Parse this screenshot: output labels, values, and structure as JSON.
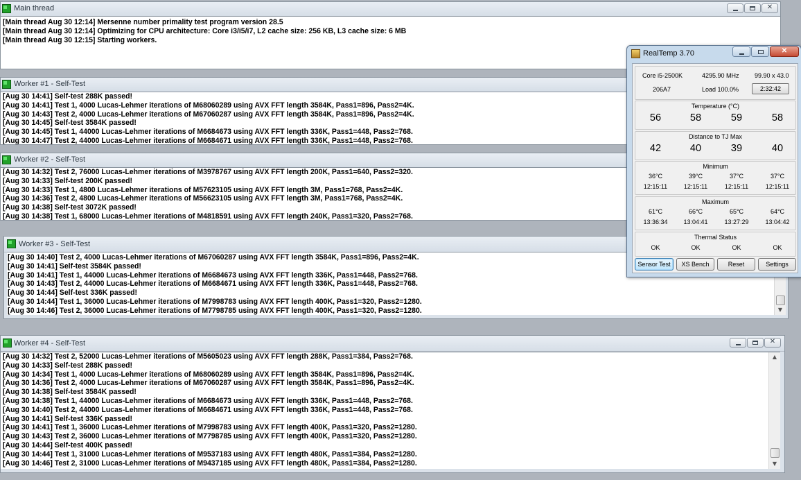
{
  "main": {
    "title": "Main thread",
    "lines": [
      "[Main thread Aug 30 12:14] Mersenne number primality test program version 28.5",
      "[Main thread Aug 30 12:14] Optimizing for CPU architecture: Core i3/i5/i7, L2 cache size: 256 KB, L3 cache size: 6 MB",
      "[Main thread Aug 30 12:15] Starting workers."
    ]
  },
  "workers": [
    {
      "title": "Worker #1 - Self-Test",
      "lines": [
        "[Aug 30 14:41] Self-test 288K passed!",
        "[Aug 30 14:41] Test 1, 4000 Lucas-Lehmer iterations of M68060289 using AVX FFT length 3584K, Pass1=896, Pass2=4K.",
        "[Aug 30 14:43] Test 2, 4000 Lucas-Lehmer iterations of M67060287 using AVX FFT length 3584K, Pass1=896, Pass2=4K.",
        "[Aug 30 14:45] Self-test 3584K passed!",
        "[Aug 30 14:45] Test 1, 44000 Lucas-Lehmer iterations of M6684673 using AVX FFT length 336K, Pass1=448, Pass2=768.",
        "[Aug 30 14:47] Test 2, 44000 Lucas-Lehmer iterations of M6684671 using AVX FFT length 336K, Pass1=448, Pass2=768."
      ]
    },
    {
      "title": "Worker #2 - Self-Test",
      "lines": [
        "[Aug 30 14:32] Test 2, 76000 Lucas-Lehmer iterations of M3978767 using AVX FFT length 200K, Pass1=640, Pass2=320.",
        "[Aug 30 14:33] Self-test 200K passed!",
        "[Aug 30 14:33] Test 1, 4800 Lucas-Lehmer iterations of M57623105 using AVX FFT length 3M, Pass1=768, Pass2=4K.",
        "[Aug 30 14:36] Test 2, 4800 Lucas-Lehmer iterations of M56623105 using AVX FFT length 3M, Pass1=768, Pass2=4K.",
        "[Aug 30 14:38] Self-test 3072K passed!",
        "[Aug 30 14:38] Test 1, 68000 Lucas-Lehmer iterations of M4818591 using AVX FFT length 240K, Pass1=320, Pass2=768."
      ]
    },
    {
      "title": "Worker #3 - Self-Test",
      "lines": [
        "[Aug 30 14:40] Test 2, 4000 Lucas-Lehmer iterations of M67060287 using AVX FFT length 3584K, Pass1=896, Pass2=4K.",
        "[Aug 30 14:41] Self-test 3584K passed!",
        "[Aug 30 14:41] Test 1, 44000 Lucas-Lehmer iterations of M6684673 using AVX FFT length 336K, Pass1=448, Pass2=768.",
        "[Aug 30 14:43] Test 2, 44000 Lucas-Lehmer iterations of M6684671 using AVX FFT length 336K, Pass1=448, Pass2=768.",
        "[Aug 30 14:44] Self-test 336K passed!",
        "[Aug 30 14:44] Test 1, 36000 Lucas-Lehmer iterations of M7998783 using AVX FFT length 400K, Pass1=320, Pass2=1280.",
        "[Aug 30 14:46] Test 2, 36000 Lucas-Lehmer iterations of M7798785 using AVX FFT length 400K, Pass1=320, Pass2=1280."
      ]
    },
    {
      "title": "Worker #4 - Self-Test",
      "lines": [
        "[Aug 30 14:32] Test 2, 52000 Lucas-Lehmer iterations of M5605023 using AVX FFT length 288K, Pass1=384, Pass2=768.",
        "[Aug 30 14:33] Self-test 288K passed!",
        "[Aug 30 14:34] Test 1, 4000 Lucas-Lehmer iterations of M68060289 using AVX FFT length 3584K, Pass1=896, Pass2=4K.",
        "[Aug 30 14:36] Test 2, 4000 Lucas-Lehmer iterations of M67060287 using AVX FFT length 3584K, Pass1=896, Pass2=4K.",
        "[Aug 30 14:38] Self-test 3584K passed!",
        "[Aug 30 14:38] Test 1, 44000 Lucas-Lehmer iterations of M6684673 using AVX FFT length 336K, Pass1=448, Pass2=768.",
        "[Aug 30 14:40] Test 2, 44000 Lucas-Lehmer iterations of M6684671 using AVX FFT length 336K, Pass1=448, Pass2=768.",
        "[Aug 30 14:41] Self-test 336K passed!",
        "[Aug 30 14:41] Test 1, 36000 Lucas-Lehmer iterations of M7998783 using AVX FFT length 400K, Pass1=320, Pass2=1280.",
        "[Aug 30 14:43] Test 2, 36000 Lucas-Lehmer iterations of M7798785 using AVX FFT length 400K, Pass1=320, Pass2=1280.",
        "[Aug 30 14:44] Self-test 400K passed!",
        "[Aug 30 14:44] Test 1, 31000 Lucas-Lehmer iterations of M9537183 using AVX FFT length 480K, Pass1=384, Pass2=1280.",
        "[Aug 30 14:46] Test 2, 31000 Lucas-Lehmer iterations of M9437185 using AVX FFT length 480K, Pass1=384, Pass2=1280."
      ]
    }
  ],
  "realtemp": {
    "title": "RealTemp 3.70",
    "cpu": "Core i5-2500K",
    "mhz": "4295.90 MHz",
    "multiplier": "99.90 x 43.0",
    "cpuid": "206A7",
    "load": "Load 100.0%",
    "timer": "2:32:42",
    "temperature": {
      "label": "Temperature (°C)",
      "values": [
        "56",
        "58",
        "59",
        "58"
      ]
    },
    "distance": {
      "label": "Distance to TJ Max",
      "values": [
        "42",
        "40",
        "39",
        "40"
      ]
    },
    "minimum": {
      "label": "Minimum",
      "values": [
        "36°C",
        "39°C",
        "37°C",
        "37°C"
      ],
      "times": [
        "12:15:11",
        "12:15:11",
        "12:15:11",
        "12:15:11"
      ]
    },
    "maximum": {
      "label": "Maximum",
      "values": [
        "61°C",
        "66°C",
        "65°C",
        "64°C"
      ],
      "times": [
        "13:36:34",
        "13:04:41",
        "13:27:29",
        "13:04:42"
      ]
    },
    "thermal": {
      "label": "Thermal Status",
      "values": [
        "OK",
        "OK",
        "OK",
        "OK"
      ]
    },
    "buttons": {
      "sensor_test": "Sensor Test",
      "xs_bench": "XS Bench",
      "reset": "Reset",
      "settings": "Settings"
    }
  }
}
